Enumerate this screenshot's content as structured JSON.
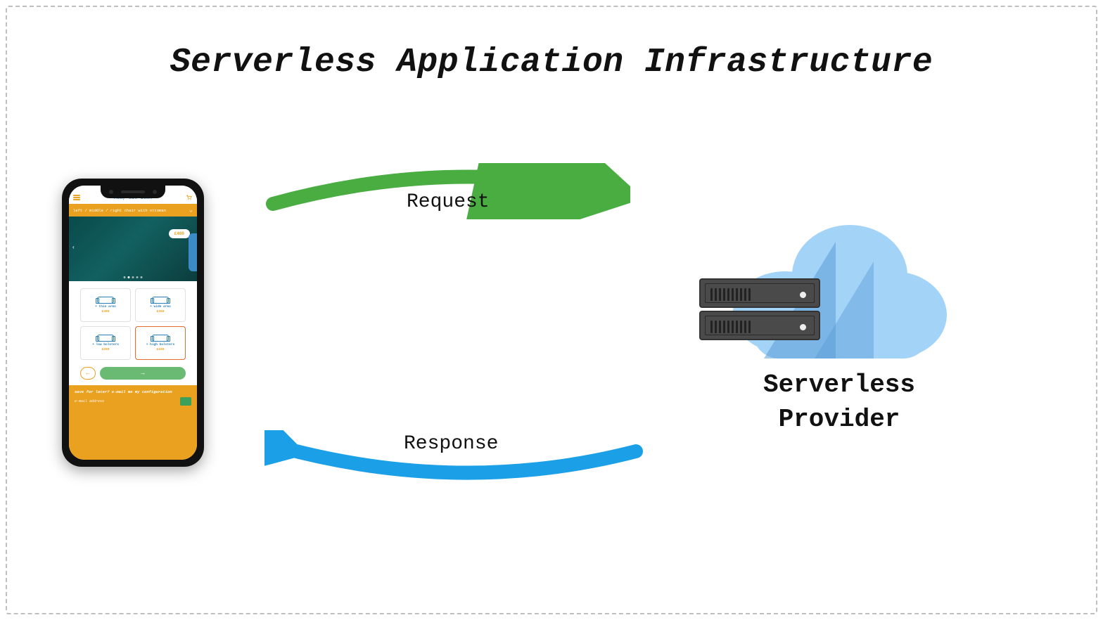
{
  "title": "Serverless Application Infrastructure",
  "arrows": {
    "request": "Request",
    "response": "Response"
  },
  "provider_label_line1": "Serverless",
  "provider_label_line2": "Provider",
  "colors": {
    "green": "#4aad42",
    "blue_arrow": "#1ba0e8",
    "cloud_light": "#a3d3f7",
    "cloud_shadow": "#5a9cd8",
    "yellow": "#eaa11f",
    "orange": "#e86b2c",
    "teal": "#2a7fb8",
    "server": "#4a4a4a"
  },
  "phone": {
    "app_title": "now, sit down",
    "banner": "left / middle / right chair with ottoman",
    "hero": {
      "price": "£480"
    },
    "options": [
      {
        "label": "+ thin arms",
        "price": "£300",
        "selected": false
      },
      {
        "label": "+ wide arms",
        "price": "£350",
        "selected": false
      },
      {
        "label": "+ low bolsters",
        "price": "£200",
        "selected": false
      },
      {
        "label": "+ high bolsters",
        "price": "£200",
        "selected": true
      }
    ],
    "save": {
      "title": "save for later? e-mail me my configuration",
      "field_label": "e-mail address"
    }
  }
}
